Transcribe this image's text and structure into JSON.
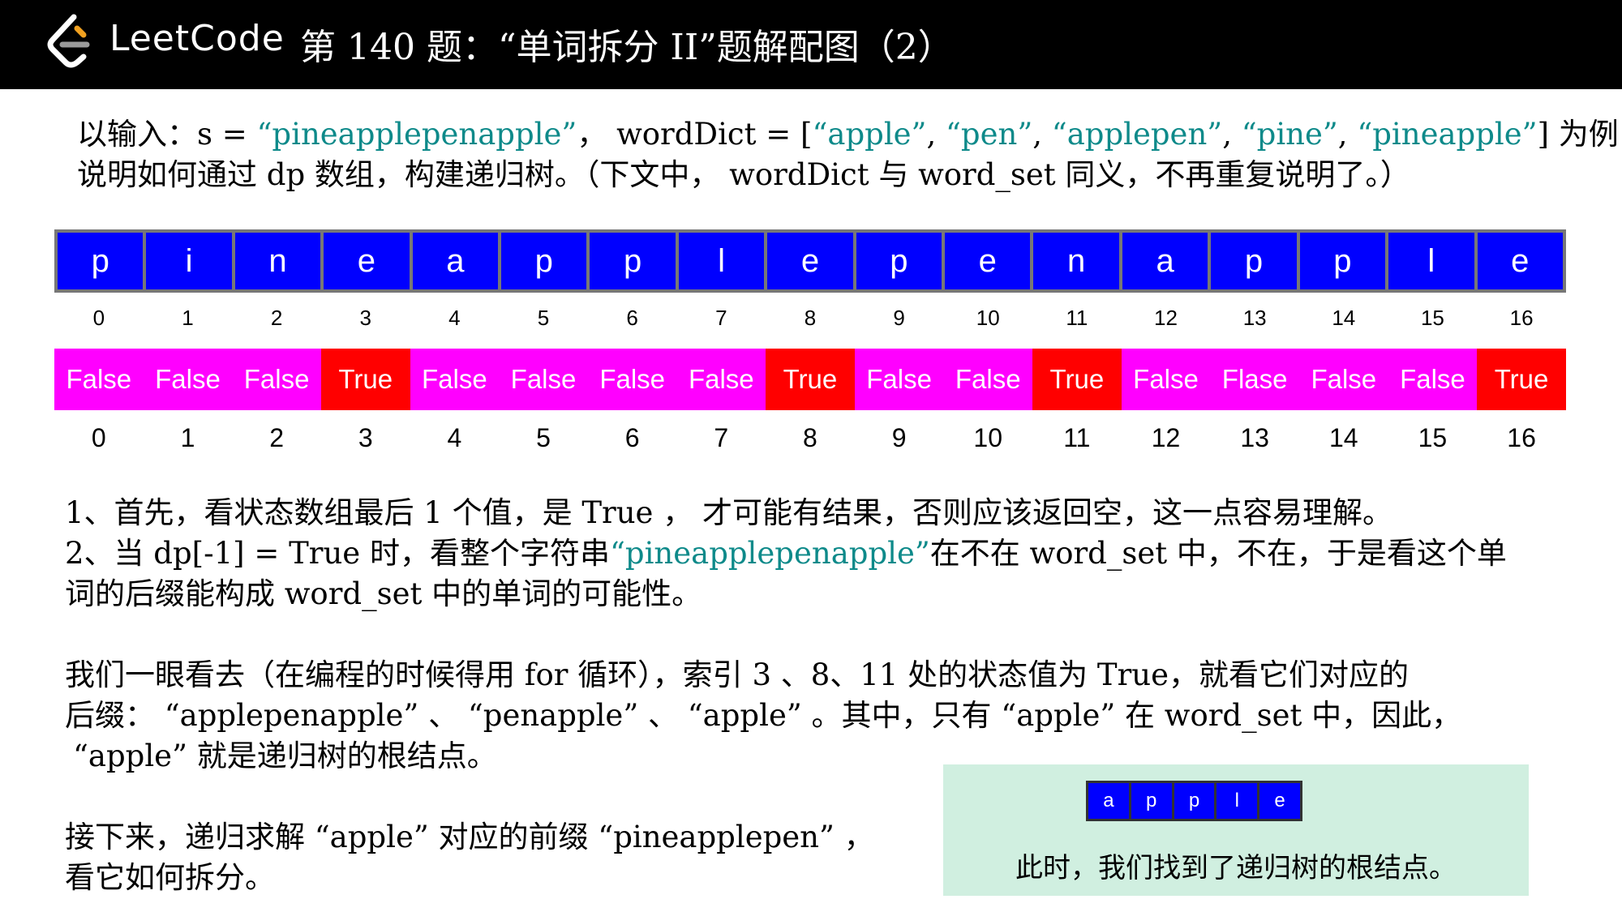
{
  "header": {
    "brand": "LeetCode",
    "title": "第 140 题：“单词拆分 II”题解配图（2）"
  },
  "intro": {
    "l1a": "以输入：s = ",
    "l1_s": "“pineapplepenapple”",
    "l1b": "， wordDict = [",
    "w1": "“apple”",
    "sep1": ", ",
    "w2": "“pen”",
    "sep2": ", ",
    "w3": "“applepen”",
    "sep3": ", ",
    "w4": "“pine”",
    "sep4": ", ",
    "w5": "“pineapple”",
    "l1c": "] 为例，",
    "l2": "说明如何通过 dp 数组，构建递归树。（下文中， wordDict 与 word_set 同义，不再重复说明了。）"
  },
  "chars": [
    "p",
    "i",
    "n",
    "e",
    "a",
    "p",
    "p",
    "l",
    "e",
    "p",
    "e",
    "n",
    "a",
    "p",
    "p",
    "l",
    "e"
  ],
  "char_indices": [
    "0",
    "1",
    "2",
    "3",
    "4",
    "5",
    "6",
    "7",
    "8",
    "9",
    "10",
    "11",
    "12",
    "13",
    "14",
    "15",
    "16"
  ],
  "dp_values": [
    "False",
    "False",
    "False",
    "True",
    "False",
    "False",
    "False",
    "False",
    "True",
    "False",
    "False",
    "True",
    "False",
    "Flase",
    "False",
    "False",
    "True"
  ],
  "dp_indices": [
    "0",
    "1",
    "2",
    "3",
    "4",
    "5",
    "6",
    "7",
    "8",
    "9",
    "10",
    "11",
    "12",
    "13",
    "14",
    "15",
    "16"
  ],
  "colors": {
    "char_cell": "#0000ff",
    "dp_false": "#ff00ff",
    "dp_true": "#ff0000",
    "highlight_text": "#0e8a8a",
    "callout_bg": "#d0efe0"
  },
  "steps": {
    "s1": "1、首先，看状态数组最后 1 个值，是 True ， 才可能有结果，否则应该返回空，这一点容易理解。",
    "s2a": "2、当 dp[-1] = True 时，看整个字符串",
    "s2_hl": "“pineapplepenapple”",
    "s2b": "在不在 word_set 中，不在，于是看这个单",
    "s2c": "词的后缀能构成 word_set 中的单词的可能性。"
  },
  "analysis": {
    "l1": "我们一眼看去（在编程的时候得用 for 循环），索引 3 、8、11 处的状态值为 True，就看它们对应的",
    "l2": "后缀： “applepenapple” 、 “penapple” 、 “apple” 。其中，只有 “apple” 在 word_set 中，因此，",
    "l3": "“apple” 就是递归树的根结点。"
  },
  "next": {
    "l1": "接下来，递归求解 “apple” 对应的前缀 “pineapplepen” ，",
    "l2": "看它如何拆分。"
  },
  "callout": {
    "chars": [
      "a",
      "p",
      "p",
      "l",
      "e"
    ],
    "text": "此时，我们找到了递归树的根结点。"
  }
}
